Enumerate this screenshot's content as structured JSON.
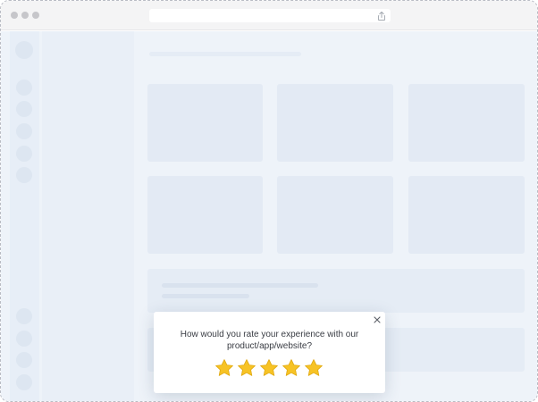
{
  "browser": {
    "address_bar_value": "",
    "share_icon": "share-icon"
  },
  "popup": {
    "question_line1": "How would you rate your experience with our",
    "question_line2": "product/app/website?",
    "close_icon": "close-icon",
    "stars_filled": 5,
    "stars_total": 5,
    "star_color": "#f7c325",
    "star_stroke_color": "#e0a912"
  },
  "colors": {
    "background": "#eef3f9",
    "skeleton": "#e3eaf4",
    "chrome": "#f4f4f5"
  }
}
